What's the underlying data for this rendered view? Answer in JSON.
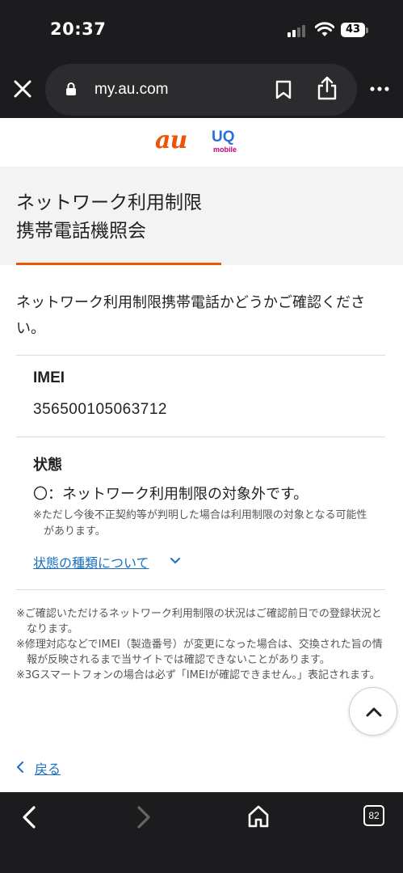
{
  "status_bar": {
    "time": "20:37",
    "battery": "43"
  },
  "browser": {
    "url": "my.au.com"
  },
  "logos": {
    "au": "au",
    "uq": "UQ",
    "uq_sub": "mobile"
  },
  "page": {
    "title_lines": [
      "ネットワーク利用制限",
      "携帯電話機照会"
    ],
    "intro": "ネットワーク利用制限携帯電話かどうかご確認ください。",
    "imei_label": "IMEI",
    "imei_value": "356500105063712",
    "status_label": "状態",
    "status_value": "〇：ネットワーク利用制限の対象外です。",
    "status_note": "※ただし今後不正契約等が判明した場合は利用制限の対象となる可能性があります。",
    "status_types_link": "状態の種類について",
    "footnotes": [
      "※ご確認いただけるネットワーク利用制限の状況はご確認前日での登録状況となります。",
      "※修理対応などでIMEI（製造番号）が変更になった場合は、交換された旨の情報が反映されるまで当サイトでは確認できないことがあります。",
      "※3Gスマートフォンの場合は必ず「IMEIが確認できません。」表記されます。"
    ],
    "back_link": "戻る"
  },
  "toolbar": {
    "tab_count": "82"
  },
  "colors": {
    "accent_orange": "#eb5505",
    "link_blue": "#1a6fc0",
    "uq_blue": "#2a6fd6",
    "uq_magenta": "#c4007a"
  },
  "icons": [
    "close-icon",
    "lock-icon",
    "bookmark-icon",
    "share-icon",
    "more-icon",
    "chevron-down-icon",
    "chevron-up-icon",
    "chevron-left-icon",
    "back-arrow-icon",
    "forward-arrow-icon",
    "home-icon",
    "tabs-icon",
    "signal-icon",
    "wifi-icon",
    "battery-icon"
  ]
}
